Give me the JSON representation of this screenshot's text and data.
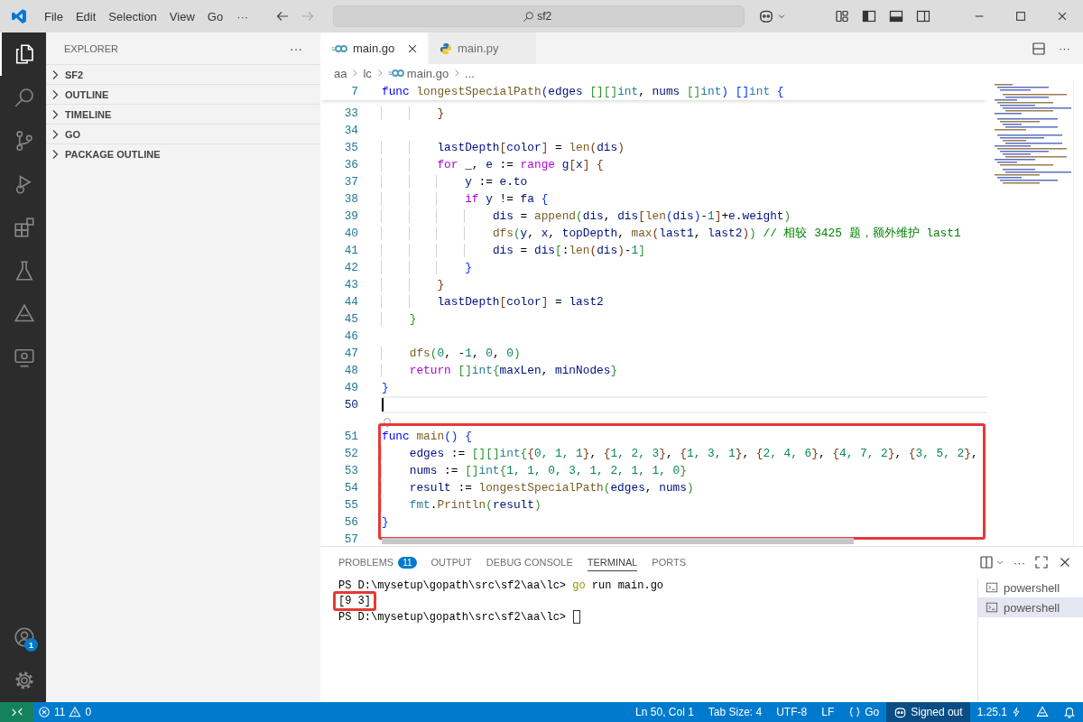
{
  "title_bar": {
    "menus": [
      "File",
      "Edit",
      "Selection",
      "View",
      "Go"
    ],
    "more": "···",
    "search": {
      "value": "sf2"
    }
  },
  "activity_bar": {
    "items": [
      {
        "kind": "files",
        "selected": true
      },
      {
        "kind": "search",
        "selected": false
      },
      {
        "kind": "scm",
        "selected": false
      },
      {
        "kind": "debug",
        "selected": false
      },
      {
        "kind": "extensions",
        "selected": false
      },
      {
        "kind": "testing",
        "selected": false
      },
      {
        "kind": "triangle",
        "selected": false
      },
      {
        "kind": "remote",
        "selected": false
      }
    ],
    "account_badge": "1"
  },
  "sidebar": {
    "title": "EXPLORER",
    "more": "···",
    "sections": [
      {
        "label": "SF2",
        "expanded": false
      },
      {
        "label": "OUTLINE",
        "expanded": false
      },
      {
        "label": "TIMELINE",
        "expanded": false
      },
      {
        "label": "GO",
        "expanded": false
      },
      {
        "label": "PACKAGE OUTLINE",
        "expanded": false
      }
    ]
  },
  "editor": {
    "tabs": [
      {
        "label": "main.go",
        "kind": "go",
        "selected": true
      },
      {
        "label": "main.py",
        "kind": "python",
        "selected": false
      }
    ],
    "more": "···",
    "breadcrumbs": [
      {
        "label": "aa",
        "kind": "folder"
      },
      {
        "label": "lc",
        "kind": "folder"
      },
      {
        "label": "main.go",
        "kind": "go"
      },
      {
        "label": "...",
        "kind": "folder"
      }
    ],
    "sticky_line": {
      "number": "7",
      "tokens": [
        {
          "text": "func",
          "kind": "kw"
        },
        {
          "text": " longestSpecialPath",
          "kind": "fn"
        },
        {
          "text": "(",
          "kind": "b1"
        },
        {
          "text": "edges",
          "kind": "var"
        },
        {
          "text": " [][]",
          "kind": "b2"
        },
        {
          "text": "int",
          "kind": "type"
        },
        {
          "text": ", ",
          "kind": "op"
        },
        {
          "text": "nums",
          "kind": "var"
        },
        {
          "text": " []",
          "kind": "b2"
        },
        {
          "text": "int",
          "kind": "type"
        },
        {
          "text": ")",
          "kind": "b1"
        },
        {
          "text": " []",
          "kind": "b1"
        },
        {
          "text": "int",
          "kind": "type"
        },
        {
          "text": " {",
          "kind": "b1"
        }
      ]
    },
    "blocks": [
      {
        "highlighted": false,
        "lines": [
          {
            "number": "33",
            "current": false,
            "tokens": [
              {
                "text": "        }",
                "kind": "b3"
              }
            ]
          },
          {
            "number": "34",
            "current": false
          },
          {
            "number": "35",
            "current": false,
            "tokens": [
              {
                "text": "        lastDepth",
                "kind": "var"
              },
              {
                "text": "[",
                "kind": "b3"
              },
              {
                "text": "color",
                "kind": "var"
              },
              {
                "text": "]",
                "kind": "b3"
              },
              {
                "text": " = ",
                "kind": "op"
              },
              {
                "text": "len",
                "kind": "fn"
              },
              {
                "text": "(",
                "kind": "b3"
              },
              {
                "text": "dis",
                "kind": "var"
              },
              {
                "text": ")",
                "kind": "b3"
              }
            ]
          },
          {
            "number": "36",
            "current": false,
            "tokens": [
              {
                "text": "        for",
                "kind": "ctl"
              },
              {
                "text": " _, ",
                "kind": "op"
              },
              {
                "text": "e",
                "kind": "var"
              },
              {
                "text": " := ",
                "kind": "op"
              },
              {
                "text": "range",
                "kind": "ctl"
              },
              {
                "text": " g",
                "kind": "var"
              },
              {
                "text": "[",
                "kind": "b3"
              },
              {
                "text": "x",
                "kind": "var"
              },
              {
                "text": "]",
                "kind": "b3"
              },
              {
                "text": " {",
                "kind": "b3"
              }
            ]
          },
          {
            "number": "37",
            "current": false,
            "tokens": [
              {
                "text": "            y",
                "kind": "var"
              },
              {
                "text": " := ",
                "kind": "op"
              },
              {
                "text": "e",
                "kind": "var"
              },
              {
                "text": ".",
                "kind": "op"
              },
              {
                "text": "to",
                "kind": "var"
              }
            ]
          },
          {
            "number": "38",
            "current": false,
            "tokens": [
              {
                "text": "            if",
                "kind": "ctl"
              },
              {
                "text": " y",
                "kind": "var"
              },
              {
                "text": " != ",
                "kind": "op"
              },
              {
                "text": "fa",
                "kind": "var"
              },
              {
                "text": " {",
                "kind": "b1"
              }
            ]
          },
          {
            "number": "39",
            "current": false,
            "tokens": [
              {
                "text": "                dis",
                "kind": "var"
              },
              {
                "text": " = ",
                "kind": "op"
              },
              {
                "text": "append",
                "kind": "fn"
              },
              {
                "text": "(",
                "kind": "b2"
              },
              {
                "text": "dis",
                "kind": "var"
              },
              {
                "text": ", ",
                "kind": "op"
              },
              {
                "text": "dis",
                "kind": "var"
              },
              {
                "text": "[",
                "kind": "b3"
              },
              {
                "text": "len",
                "kind": "fn"
              },
              {
                "text": "(",
                "kind": "b1"
              },
              {
                "text": "dis",
                "kind": "var"
              },
              {
                "text": ")",
                "kind": "b1"
              },
              {
                "text": "-",
                "kind": "op"
              },
              {
                "text": "1",
                "kind": "num"
              },
              {
                "text": "]",
                "kind": "b3"
              },
              {
                "text": "+",
                "kind": "op"
              },
              {
                "text": "e",
                "kind": "var"
              },
              {
                "text": ".",
                "kind": "op"
              },
              {
                "text": "weight",
                "kind": "var"
              },
              {
                "text": ")",
                "kind": "b2"
              }
            ]
          },
          {
            "number": "40",
            "current": false,
            "tokens": [
              {
                "text": "                dfs",
                "kind": "fn"
              },
              {
                "text": "(",
                "kind": "b2"
              },
              {
                "text": "y",
                "kind": "var"
              },
              {
                "text": ", ",
                "kind": "op"
              },
              {
                "text": "x",
                "kind": "var"
              },
              {
                "text": ", ",
                "kind": "op"
              },
              {
                "text": "topDepth",
                "kind": "var"
              },
              {
                "text": ", ",
                "kind": "op"
              },
              {
                "text": "max",
                "kind": "fn"
              },
              {
                "text": "(",
                "kind": "b3"
              },
              {
                "text": "last1",
                "kind": "var"
              },
              {
                "text": ", ",
                "kind": "op"
              },
              {
                "text": "last2",
                "kind": "var"
              },
              {
                "text": ")",
                "kind": "b3"
              },
              {
                "text": ")",
                "kind": "b2"
              },
              {
                "text": " // 相较 3425 题，额外维护 last1",
                "kind": "cmt"
              }
            ]
          },
          {
            "number": "41",
            "current": false,
            "tokens": [
              {
                "text": "                dis",
                "kind": "var"
              },
              {
                "text": " = ",
                "kind": "op"
              },
              {
                "text": "dis",
                "kind": "var"
              },
              {
                "text": "[",
                "kind": "b2"
              },
              {
                "text": ":",
                "kind": "op"
              },
              {
                "text": "len",
                "kind": "fn"
              },
              {
                "text": "(",
                "kind": "b3"
              },
              {
                "text": "dis",
                "kind": "var"
              },
              {
                "text": ")",
                "kind": "b3"
              },
              {
                "text": "-",
                "kind": "op"
              },
              {
                "text": "1",
                "kind": "num"
              },
              {
                "text": "]",
                "kind": "b2"
              }
            ]
          },
          {
            "number": "42",
            "current": false,
            "tokens": [
              {
                "text": "            }",
                "kind": "b1"
              }
            ]
          },
          {
            "number": "43",
            "current": false,
            "tokens": [
              {
                "text": "        }",
                "kind": "b3"
              }
            ]
          },
          {
            "number": "44",
            "current": false,
            "tokens": [
              {
                "text": "        lastDepth",
                "kind": "var"
              },
              {
                "text": "[",
                "kind": "b3"
              },
              {
                "text": "color",
                "kind": "var"
              },
              {
                "text": "]",
                "kind": "b3"
              },
              {
                "text": " = ",
                "kind": "op"
              },
              {
                "text": "last2",
                "kind": "var"
              }
            ]
          },
          {
            "number": "45",
            "current": false,
            "tokens": [
              {
                "text": "    }",
                "kind": "b2"
              }
            ]
          },
          {
            "number": "46",
            "current": false
          },
          {
            "number": "47",
            "current": false,
            "tokens": [
              {
                "text": "    dfs",
                "kind": "fn"
              },
              {
                "text": "(",
                "kind": "b2"
              },
              {
                "text": "0",
                "kind": "num"
              },
              {
                "text": ", -",
                "kind": "op"
              },
              {
                "text": "1",
                "kind": "num"
              },
              {
                "text": ", ",
                "kind": "op"
              },
              {
                "text": "0",
                "kind": "num"
              },
              {
                "text": ", ",
                "kind": "op"
              },
              {
                "text": "0",
                "kind": "num"
              },
              {
                "text": ")",
                "kind": "b2"
              }
            ]
          },
          {
            "number": "48",
            "current": false,
            "tokens": [
              {
                "text": "    return",
                "kind": "ctl"
              },
              {
                "text": " []",
                "kind": "b2"
              },
              {
                "text": "int",
                "kind": "type"
              },
              {
                "text": "{",
                "kind": "b2"
              },
              {
                "text": "maxLen",
                "kind": "var"
              },
              {
                "text": ", ",
                "kind": "op"
              },
              {
                "text": "minNodes",
                "kind": "var"
              },
              {
                "text": "}",
                "kind": "b2"
              }
            ]
          },
          {
            "number": "49",
            "current": false,
            "tokens": [
              {
                "text": "}",
                "kind": "b1"
              }
            ]
          },
          {
            "number": "50",
            "current": true
          }
        ]
      },
      {
        "highlighted": true,
        "lines": [
          {
            "number": "51",
            "current": false,
            "tokens": [
              {
                "text": "func",
                "kind": "kw"
              },
              {
                "text": " main",
                "kind": "fn"
              },
              {
                "text": "()",
                "kind": "b1"
              },
              {
                "text": " {",
                "kind": "b1"
              }
            ]
          },
          {
            "number": "52",
            "current": false,
            "tokens": [
              {
                "text": "    edges",
                "kind": "var"
              },
              {
                "text": " := ",
                "kind": "op"
              },
              {
                "text": "[][]",
                "kind": "b2"
              },
              {
                "text": "int",
                "kind": "type"
              },
              {
                "text": "{",
                "kind": "b2"
              },
              {
                "text": "{",
                "kind": "b3"
              },
              {
                "text": "0, 1, 1",
                "kind": "num"
              },
              {
                "text": "}",
                "kind": "b3"
              },
              {
                "text": ", ",
                "kind": "op"
              },
              {
                "text": "{",
                "kind": "b3"
              },
              {
                "text": "1, 2, 3",
                "kind": "num"
              },
              {
                "text": "}",
                "kind": "b3"
              },
              {
                "text": ", ",
                "kind": "op"
              },
              {
                "text": "{",
                "kind": "b3"
              },
              {
                "text": "1, 3, 1",
                "kind": "num"
              },
              {
                "text": "}",
                "kind": "b3"
              },
              {
                "text": ", ",
                "kind": "op"
              },
              {
                "text": "{",
                "kind": "b3"
              },
              {
                "text": "2, 4, 6",
                "kind": "num"
              },
              {
                "text": "}",
                "kind": "b3"
              },
              {
                "text": ", ",
                "kind": "op"
              },
              {
                "text": "{",
                "kind": "b3"
              },
              {
                "text": "4, 7, 2",
                "kind": "num"
              },
              {
                "text": "}",
                "kind": "b3"
              },
              {
                "text": ", ",
                "kind": "op"
              },
              {
                "text": "{",
                "kind": "b3"
              },
              {
                "text": "3, 5, 2",
                "kind": "num"
              },
              {
                "text": "}",
                "kind": "b3"
              },
              {
                "text": ",",
                "kind": "op"
              }
            ]
          },
          {
            "number": "53",
            "current": false,
            "tokens": [
              {
                "text": "    nums",
                "kind": "var"
              },
              {
                "text": " := ",
                "kind": "op"
              },
              {
                "text": "[]",
                "kind": "b2"
              },
              {
                "text": "int",
                "kind": "type"
              },
              {
                "text": "{",
                "kind": "b2"
              },
              {
                "text": "1, 1, 0, 3, 1, 2, 1, 1, 0",
                "kind": "num"
              },
              {
                "text": "}",
                "kind": "b2"
              }
            ]
          },
          {
            "number": "54",
            "current": false,
            "tokens": [
              {
                "text": "    result",
                "kind": "var"
              },
              {
                "text": " := ",
                "kind": "op"
              },
              {
                "text": "longestSpecialPath",
                "kind": "fn"
              },
              {
                "text": "(",
                "kind": "b2"
              },
              {
                "text": "edges",
                "kind": "var"
              },
              {
                "text": ", ",
                "kind": "op"
              },
              {
                "text": "nums",
                "kind": "var"
              },
              {
                "text": ")",
                "kind": "b2"
              }
            ]
          },
          {
            "number": "55",
            "current": false,
            "tokens": [
              {
                "text": "    fmt",
                "kind": "type"
              },
              {
                "text": ".",
                "kind": "op"
              },
              {
                "text": "Println",
                "kind": "fn"
              },
              {
                "text": "(",
                "kind": "b2"
              },
              {
                "text": "result",
                "kind": "var"
              },
              {
                "text": ")",
                "kind": "b2"
              }
            ]
          },
          {
            "number": "56",
            "current": false,
            "tokens": [
              {
                "text": "}",
                "kind": "b1"
              }
            ]
          },
          {
            "number": "57",
            "current": false
          }
        ]
      }
    ]
  },
  "panel": {
    "tabs": [
      {
        "label": "PROBLEMS",
        "badge": "11",
        "selected": false
      },
      {
        "label": "OUTPUT",
        "selected": false
      },
      {
        "label": "DEBUG CONSOLE",
        "selected": false
      },
      {
        "label": "TERMINAL",
        "selected": true
      },
      {
        "label": "PORTS",
        "selected": false
      }
    ],
    "more": "···",
    "terminal": {
      "lines": [
        {
          "highlighted": false,
          "cursor": false,
          "tokens": [
            {
              "text": "PS D:\\mysetup\\gopath\\src\\sf2\\aa\\lc> ",
              "kind": "op"
            },
            {
              "text": "go",
              "kind": "cmd"
            },
            {
              "text": " run main.go",
              "kind": "op"
            }
          ]
        },
        {
          "highlighted": true,
          "cursor": false,
          "tokens": [
            {
              "text": "[9 3]",
              "kind": "op"
            }
          ]
        },
        {
          "highlighted": false,
          "cursor": true,
          "tokens": [
            {
              "text": "PS D:\\mysetup\\gopath\\src\\sf2\\aa\\lc> ",
              "kind": "op"
            }
          ]
        }
      ]
    },
    "sessions": [
      {
        "label": "powershell",
        "selected": false
      },
      {
        "label": "powershell",
        "selected": true
      }
    ]
  },
  "status_bar": {
    "errors": "11",
    "warnings": "0",
    "items": [
      {
        "label": "Ln 50, Col 1",
        "kind": "plain"
      },
      {
        "label": "Tab Size: 4",
        "kind": "plain"
      },
      {
        "label": "UTF-8",
        "kind": "plain"
      },
      {
        "label": "LF",
        "kind": "plain"
      },
      {
        "label": "Go",
        "kind": "braces"
      },
      {
        "label": "Signed out",
        "kind": "account"
      },
      {
        "label": "1.25.1",
        "kind": "version"
      }
    ]
  }
}
